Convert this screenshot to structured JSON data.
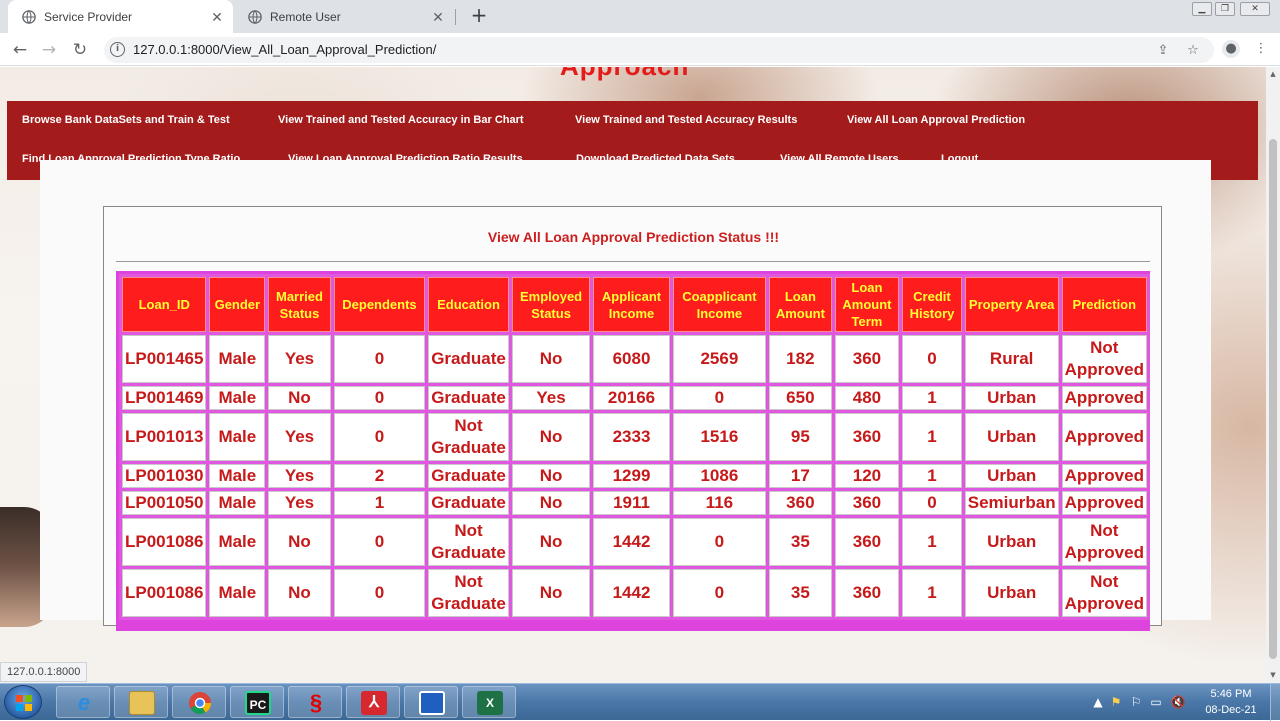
{
  "browser": {
    "tabs": [
      {
        "label": "Service Provider",
        "active": true
      },
      {
        "label": "Remote User",
        "active": false
      }
    ],
    "new_tab": "+",
    "address_url": "127.0.0.1:8000/View_All_Loan_Approval_Prediction/",
    "status_url": "127.0.0.1:8000"
  },
  "page": {
    "heading_fragment": "Approach",
    "status_title": "View All Loan Approval Prediction Status !!!"
  },
  "nav": {
    "row1": [
      "Browse Bank DataSets and Train & Test",
      "View Trained and Tested Accuracy in Bar Chart",
      "View Trained and Tested Accuracy Results",
      "View All Loan Approval Prediction"
    ],
    "row2": [
      "Find Loan Approval Prediction Type Ratio",
      "View Loan Approval Prediction Ratio Results",
      "Download Predicted Data Sets",
      "View All Remote Users",
      "Logout"
    ]
  },
  "table": {
    "headers": [
      "Loan_ID",
      "Gender",
      "Married Status",
      "Dependents",
      "Education",
      "Employed Status",
      "Applicant Income",
      "Coapplicant Income",
      "Loan Amount",
      "Loan Amount Term",
      "Credit History",
      "Property Area",
      "Prediction"
    ],
    "rows": [
      [
        "LP001465",
        "Male",
        "Yes",
        "0",
        "Graduate",
        "No",
        "6080",
        "2569",
        "182",
        "360",
        "0",
        "Rural",
        "Not Approved"
      ],
      [
        "LP001469",
        "Male",
        "No",
        "0",
        "Graduate",
        "Yes",
        "20166",
        "0",
        "650",
        "480",
        "1",
        "Urban",
        "Approved"
      ],
      [
        "LP001013",
        "Male",
        "Yes",
        "0",
        "Not Graduate",
        "No",
        "2333",
        "1516",
        "95",
        "360",
        "1",
        "Urban",
        "Approved"
      ],
      [
        "LP001030",
        "Male",
        "Yes",
        "2",
        "Graduate",
        "No",
        "1299",
        "1086",
        "17",
        "120",
        "1",
        "Urban",
        "Approved"
      ],
      [
        "LP001050",
        "Male",
        "Yes",
        "1",
        "Graduate",
        "No",
        "1911",
        "116",
        "360",
        "360",
        "0",
        "Semiurban",
        "Approved"
      ],
      [
        "LP001086",
        "Male",
        "No",
        "0",
        "Not Graduate",
        "No",
        "1442",
        "0",
        "35",
        "360",
        "1",
        "Urban",
        "Not Approved"
      ],
      [
        "LP001086",
        "Male",
        "No",
        "0",
        "Not Graduate",
        "No",
        "1442",
        "0",
        "35",
        "360",
        "1",
        "Urban",
        "Not Approved"
      ]
    ]
  },
  "taskbar": {
    "apps": [
      {
        "name": "internet-explorer",
        "glyph": "e"
      },
      {
        "name": "file-explorer",
        "glyph": ""
      },
      {
        "name": "chrome",
        "glyph": ""
      },
      {
        "name": "pycharm",
        "glyph": "PC"
      },
      {
        "name": "airtel",
        "glyph": ""
      },
      {
        "name": "acrobat",
        "glyph": ""
      },
      {
        "name": "app-window",
        "glyph": ""
      },
      {
        "name": "excel",
        "glyph": "X"
      }
    ],
    "time": "5:46 PM",
    "date": "08-Dec-21"
  },
  "colors": {
    "nav_bg": "#a31b1b",
    "header_bg": "#ff1c1c",
    "header_text": "#ffff33",
    "cell_text": "#c61a1a",
    "table_border": "#dd44dd",
    "title_red": "#cc1f1f"
  }
}
